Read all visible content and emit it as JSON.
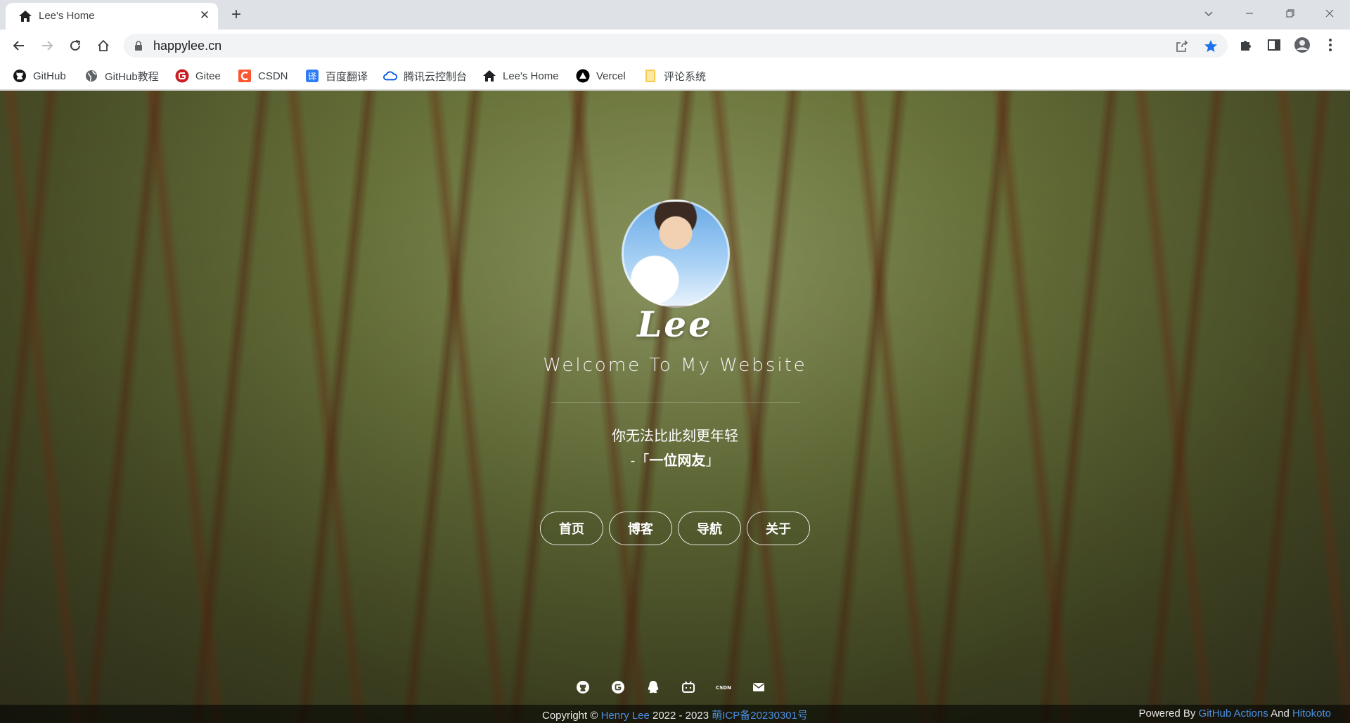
{
  "browser": {
    "tab_title": "Lee's Home",
    "url": "happylee.cn"
  },
  "bookmarks": [
    {
      "label": "GitHub",
      "icon": "github-icon"
    },
    {
      "label": "GitHub教程",
      "icon": "globe-icon"
    },
    {
      "label": "Gitee",
      "icon": "gitee-icon"
    },
    {
      "label": "CSDN",
      "icon": "csdn-icon"
    },
    {
      "label": "百度翻译",
      "icon": "baidu-translate-icon"
    },
    {
      "label": "腾讯云控制台",
      "icon": "tencent-cloud-icon"
    },
    {
      "label": "Lee's Home",
      "icon": "home-icon"
    },
    {
      "label": "Vercel",
      "icon": "vercel-icon"
    },
    {
      "label": "评论系统",
      "icon": "folder-icon"
    }
  ],
  "hero": {
    "name": "Lee",
    "welcome": "Welcome To My Website",
    "quote": "你无法比此刻更年轻",
    "quote_prefix": "-「",
    "quote_author": "一位网友",
    "quote_suffix": "」"
  },
  "nav": [
    {
      "label": "首页"
    },
    {
      "label": "博客"
    },
    {
      "label": "导航"
    },
    {
      "label": "关于"
    }
  ],
  "social": [
    "github-icon",
    "gitee-icon",
    "qq-icon",
    "bilibili-icon",
    "csdn-icon",
    "mail-icon"
  ],
  "footer": {
    "copyright_prefix": "Copyright ©",
    "author": "Henry Lee",
    "years": "2022 - 2023",
    "icp": "萌ICP备20230301号",
    "powered_by": "Powered By",
    "powered_1": "GitHub Actions",
    "and": "And",
    "powered_2": "Hitokoto"
  },
  "colors": {
    "link": "#4d8fe0",
    "star": "#1a73e8"
  }
}
